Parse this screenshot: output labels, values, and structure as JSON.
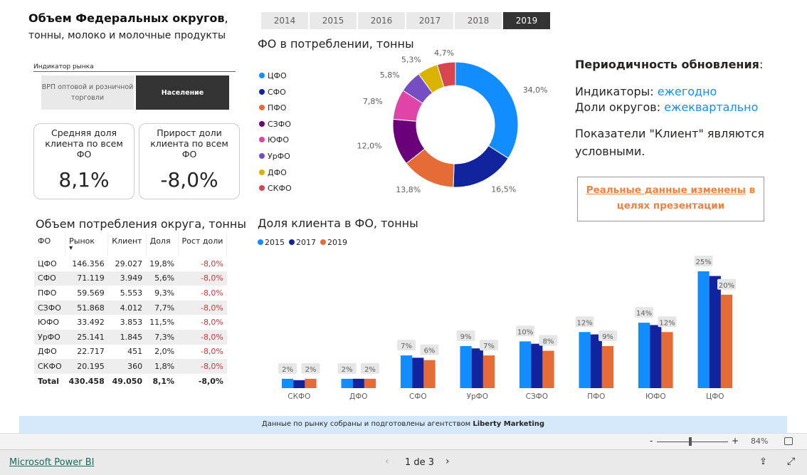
{
  "header": {
    "title": "Объем Федеральных округов",
    "title_suffix": ",",
    "subtitle": "тонны, молоко и молочные продукты"
  },
  "years": {
    "items": [
      "2014",
      "2015",
      "2016",
      "2017",
      "2018",
      "2019"
    ],
    "selected": "2019"
  },
  "slicer": {
    "label": "Индикатор рынка",
    "options": [
      "ВРП оптовой и розничной торговли",
      "Население"
    ],
    "selected": "Население"
  },
  "cards": [
    {
      "label": "Средняя доля клиента по всем ФО",
      "value": "8,1%"
    },
    {
      "label": "Прирост доли клиента по всем ФО",
      "value": "-8,0%"
    }
  ],
  "table": {
    "title": "Объем потребления округа, тонны",
    "columns": [
      "ФО",
      "Рынок",
      "Клиент",
      "Доля",
      "Рост доли"
    ],
    "sort_column": "Рынок",
    "rows": [
      [
        "ЦФО",
        "146.356",
        "29.027",
        "19,8%",
        "-8,0%"
      ],
      [
        "СФО",
        "71.119",
        "3.949",
        "5,6%",
        "-8,0%"
      ],
      [
        "ПФО",
        "59.569",
        "5.553",
        "9,3%",
        "-8,0%"
      ],
      [
        "СЗФО",
        "51.868",
        "4.012",
        "7,7%",
        "-8,0%"
      ],
      [
        "ЮФО",
        "33.492",
        "3.853",
        "11,5%",
        "-8,0%"
      ],
      [
        "УрФО",
        "25.141",
        "1.845",
        "7,3%",
        "-8,0%"
      ],
      [
        "ДФО",
        "22.717",
        "451",
        "2,0%",
        "-8,0%"
      ],
      [
        "СКФО",
        "20.195",
        "360",
        "1,8%",
        "-8,0%"
      ]
    ],
    "total": [
      "Total",
      "430.458",
      "49.050",
      "8,1%",
      "-8,0%"
    ]
  },
  "donut": {
    "title": "ФО в потреблении, тонны",
    "type": "pie",
    "categories": [
      "ЦФО",
      "СФО",
      "ПФО",
      "СЗФО",
      "ЮФО",
      "УрФО",
      "ДФО",
      "СКФО"
    ],
    "values": [
      34.0,
      16.5,
      13.8,
      12.0,
      7.8,
      5.8,
      5.3,
      4.7
    ],
    "labels": [
      "34,0%",
      "16,5%",
      "13,8%",
      "12,0%",
      "7,8%",
      "5,8%",
      "5,3%",
      "4,7%"
    ],
    "colors": [
      "#118DFF",
      "#12239E",
      "#E66C37",
      "#6B007B",
      "#E044A7",
      "#744EC2",
      "#D9B300",
      "#D64550"
    ],
    "legend": "left"
  },
  "info": {
    "title": "Периодичность обновления",
    "title_suffix": ":",
    "line1_label": "Индикаторы: ",
    "line1_value": "ежегодно",
    "line2_label": "Доли округов: ",
    "line2_value": "ежеквартально",
    "note": "Показатели \"Клиент\" являются условными."
  },
  "disclaimer": {
    "part1": "Реальные данные изменены",
    "part2": " в целях презентации"
  },
  "chart_data": {
    "type": "bar",
    "title": "Доля клиента в ФО, тонны",
    "categories": [
      "СКФО",
      "ДФО",
      "СФО",
      "УрФО",
      "СЗФО",
      "ПФО",
      "ЮФО",
      "ЦФО"
    ],
    "series": [
      {
        "name": "2015",
        "color": "#118DFF",
        "values": [
          2,
          2,
          7,
          9,
          10,
          12,
          14,
          25
        ],
        "labels": [
          "2%",
          "2%",
          "7%",
          "9%",
          "10%",
          "12%",
          "14%",
          "25%"
        ]
      },
      {
        "name": "2017",
        "color": "#12239E",
        "values": [
          1.7,
          2,
          6.5,
          8.5,
          9.5,
          11.5,
          13.5,
          24
        ]
      },
      {
        "name": "2019",
        "color": "#E66C37",
        "values": [
          2,
          2,
          6,
          7,
          8,
          9,
          12,
          20
        ],
        "labels": [
          "2%",
          "2%",
          "6%",
          "7%",
          "8%",
          "9%",
          "12%",
          "20%"
        ]
      }
    ],
    "ylim": [
      0,
      25
    ],
    "legend": "top-left",
    "grid": false
  },
  "footer": {
    "text": "Данные по рынку собраны и подготовлены агентством ",
    "brand": "Liberty Marketing"
  },
  "zoom": {
    "minus": "-",
    "plus": "+",
    "value": "84%",
    "level": 0.47
  },
  "bottom": {
    "link": "Microsoft Power BI",
    "page": "1 de 3"
  }
}
